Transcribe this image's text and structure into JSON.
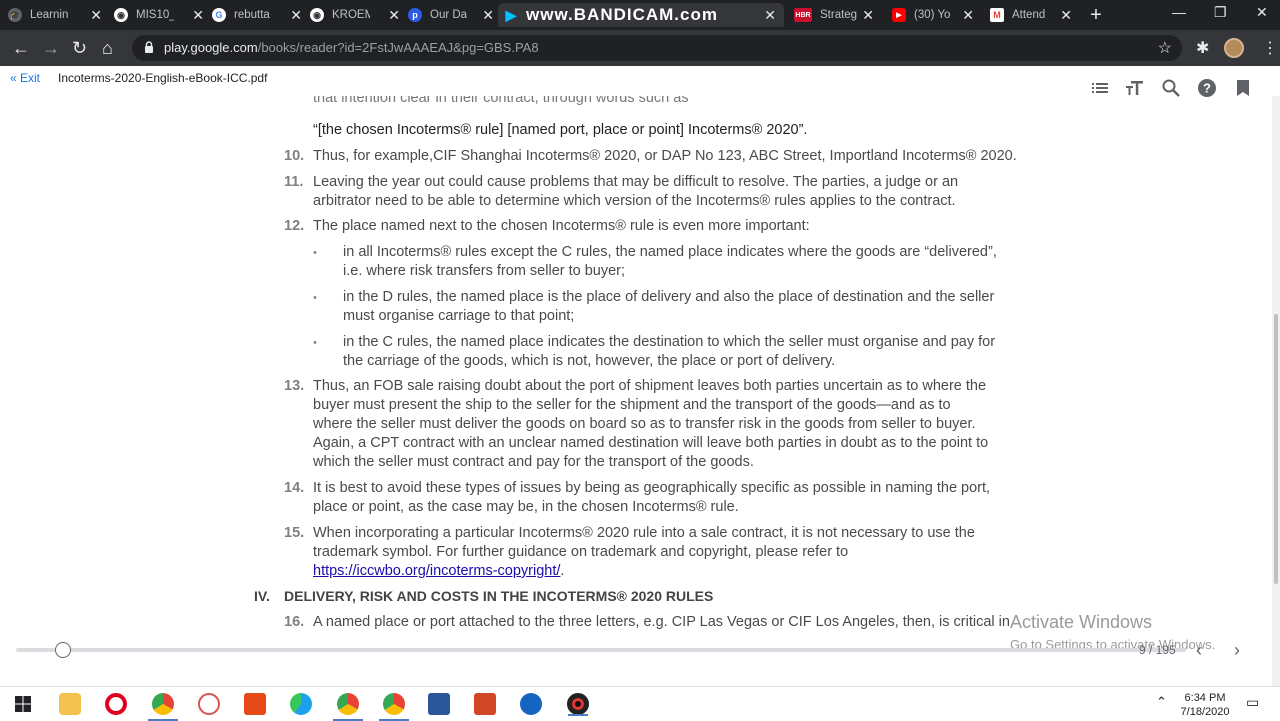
{
  "browser": {
    "tabs": [
      {
        "title": "Learnin",
        "icon": "graduation-cap-icon",
        "color": "#5f6368"
      },
      {
        "title": "MIS10_",
        "icon": "globe-icon",
        "color": "#3c4043"
      },
      {
        "title": "rebutta",
        "icon": "google-icon",
        "color": "#4285f4"
      },
      {
        "title": "KROEM",
        "icon": "globe-icon",
        "color": "#3c4043"
      },
      {
        "title": "Our Da",
        "icon": "p-icon",
        "color": "#2d5be3"
      },
      {
        "title": "www.BANDICAM.com",
        "icon": "play-icon",
        "color": "#00c3ff",
        "active": true
      },
      {
        "title": "Strateg",
        "icon": "hbr-icon",
        "color": "#c8102e"
      },
      {
        "title": "(30) Yo",
        "icon": "youtube-icon",
        "color": "#ff0000"
      },
      {
        "title": "Attend",
        "icon": "gmail-icon",
        "color": "#ea4335"
      }
    ],
    "url_domain": "play.google.com",
    "url_path": "/books/reader?id=2FstJwAAAEAJ&pg=GBS.PA8"
  },
  "reader": {
    "exit_label": "« Exit",
    "title": "Incoterms-2020-English-eBook-ICC.pdf"
  },
  "content": {
    "cut_line": "that intention clear in their contract, through words such as",
    "quote": "“[the chosen Incoterms® rule] [named port, place or point] Incoterms® 2020”.",
    "p10": {
      "num": "10.",
      "lines": [
        "Thus, for example,CIF Shanghai Incoterms® 2020, or DAP No 123, ABC Street, Importland Incoterms® 2020."
      ]
    },
    "p11": {
      "num": "11.",
      "lines": [
        "Leaving the year out could cause problems that may be difficult to resolve. The parties, a judge or an",
        "arbitrator need to be able to determine which version of the Incoterms® rules applies to the contract."
      ]
    },
    "p12": {
      "num": "12.",
      "lines": [
        "The place named next to the chosen Incoterms® rule is even more important:"
      ]
    },
    "bullets": [
      [
        "in all Incoterms® rules except the C rules, the named place indicates where the goods are “delivered”,",
        "i.e. where risk transfers from seller to buyer;"
      ],
      [
        "in the D rules, the named place is the place of delivery and also the place of destination and the seller",
        "must organise carriage to that point;"
      ],
      [
        "in the C rules, the named place indicates the destination to which the seller must organise and pay for",
        "the carriage of the goods, which is not, however, the place or port of delivery."
      ]
    ],
    "bullet_char": "•",
    "p13": {
      "num": "13.",
      "lines": [
        "Thus, an FOB sale raising doubt about the port of shipment leaves both parties uncertain as to where the",
        "buyer must present the ship to the seller for the shipment and the transport of the goods—and as to",
        "where the seller must deliver the goods on board so as to transfer risk in the goods from seller to buyer.",
        "Again, a CPT contract with an unclear named destination will leave both parties in doubt as to the point to",
        "which the seller must contract and pay for the transport of the goods."
      ]
    },
    "p14": {
      "num": "14.",
      "lines": [
        "It is best to avoid these types of issues by being as geographically specific as possible in naming the port,",
        "place or point, as the case may be, in the chosen Incoterms® rule."
      ]
    },
    "p15": {
      "num": "15.",
      "lines": [
        "When incorporating a particular Incoterms® 2020 rule into a sale contract, it is not necessary to use the",
        "trademark symbol. For further guidance on trademark and copyright, please refer to"
      ],
      "link": "https://iccwbo.org/incoterms-copyright/",
      "link_tail": "."
    },
    "heading": {
      "num": "IV.",
      "text": "DELIVERY, RISK AND COSTS IN THE INCOTERMS® 2020 RULES"
    },
    "p16": {
      "num": "16.",
      "lines": [
        "A named place or port attached to the three letters, e.g. CIP Las Vegas or CIF Los Angeles, then, is critical in"
      ]
    }
  },
  "pager": {
    "indicator": "9 / 195",
    "progress": 0.04
  },
  "watermark": {
    "line1": "Activate Windows",
    "line2": "Go to Settings to activate Windows."
  },
  "clock": {
    "time": "6:34 PM",
    "date": "7/18/2020"
  }
}
